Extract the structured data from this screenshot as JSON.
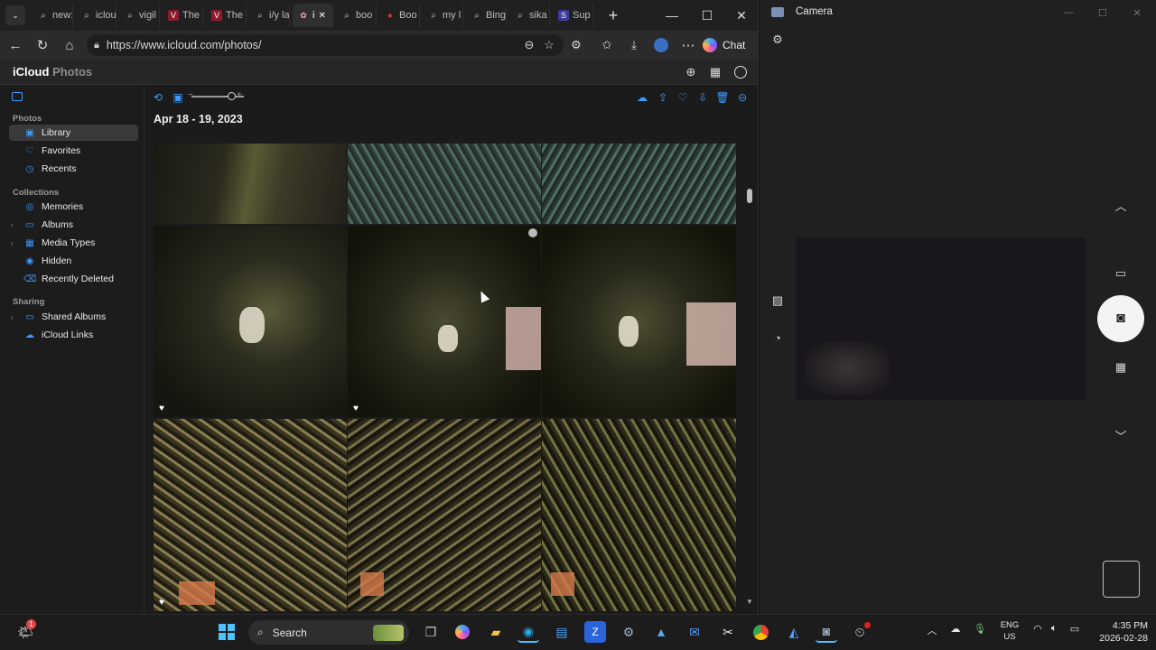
{
  "browser": {
    "tabs": [
      {
        "label": "new:",
        "icon": "search-icon"
      },
      {
        "label": "iclou",
        "icon": "search-icon"
      },
      {
        "label": "vigil",
        "icon": "search-icon"
      },
      {
        "label": "The",
        "icon": "v-logo-icon"
      },
      {
        "label": "The",
        "icon": "v-logo-icon"
      },
      {
        "label": "i/y la",
        "icon": "search-icon"
      },
      {
        "label": "i",
        "icon": "icloud-photos-icon",
        "active": true
      },
      {
        "label": "boo",
        "icon": "search-icon"
      },
      {
        "label": "Boo",
        "icon": "red-logo-icon"
      },
      {
        "label": "my l",
        "icon": "search-icon"
      },
      {
        "label": "Bing",
        "icon": "search-icon"
      },
      {
        "label": "sika",
        "icon": "search-icon"
      },
      {
        "label": "Sup",
        "icon": "s-logo-icon"
      }
    ],
    "url": "https://www.icloud.com/photos/",
    "chat_label": "Chat"
  },
  "icloud": {
    "brand": "iCloud",
    "brand_suffix": "Photos",
    "date_header": "Apr 18 - 19, 2023",
    "sidebar": {
      "photos_heading": "Photos",
      "photos_items": [
        {
          "label": "Library",
          "icon": "library-icon",
          "selected": true
        },
        {
          "label": "Favorites",
          "icon": "heart-icon"
        },
        {
          "label": "Recents",
          "icon": "clock-icon"
        }
      ],
      "collections_heading": "Collections",
      "collections_items": [
        {
          "label": "Memories",
          "icon": "memories-icon"
        },
        {
          "label": "Albums",
          "icon": "albums-icon",
          "expandable": true
        },
        {
          "label": "Media Types",
          "icon": "media-types-icon",
          "expandable": true
        },
        {
          "label": "Hidden",
          "icon": "eye-icon"
        },
        {
          "label": "Recently Deleted",
          "icon": "trash-icon"
        }
      ],
      "sharing_heading": "Sharing",
      "sharing_items": [
        {
          "label": "Shared Albums",
          "icon": "shared-albums-icon",
          "expandable": true
        },
        {
          "label": "iCloud Links",
          "icon": "cloud-icon"
        }
      ]
    }
  },
  "camera": {
    "title": "Camera"
  },
  "taskbar": {
    "search_label": "Search",
    "language_line1": "ENG",
    "language_line2": "US",
    "time": "4:35 PM",
    "date": "2026-02-28",
    "notification_count": "1"
  },
  "colors": {
    "accent_blue": "#3d9bff",
    "sidebar_selected": "#3a3a3a"
  }
}
